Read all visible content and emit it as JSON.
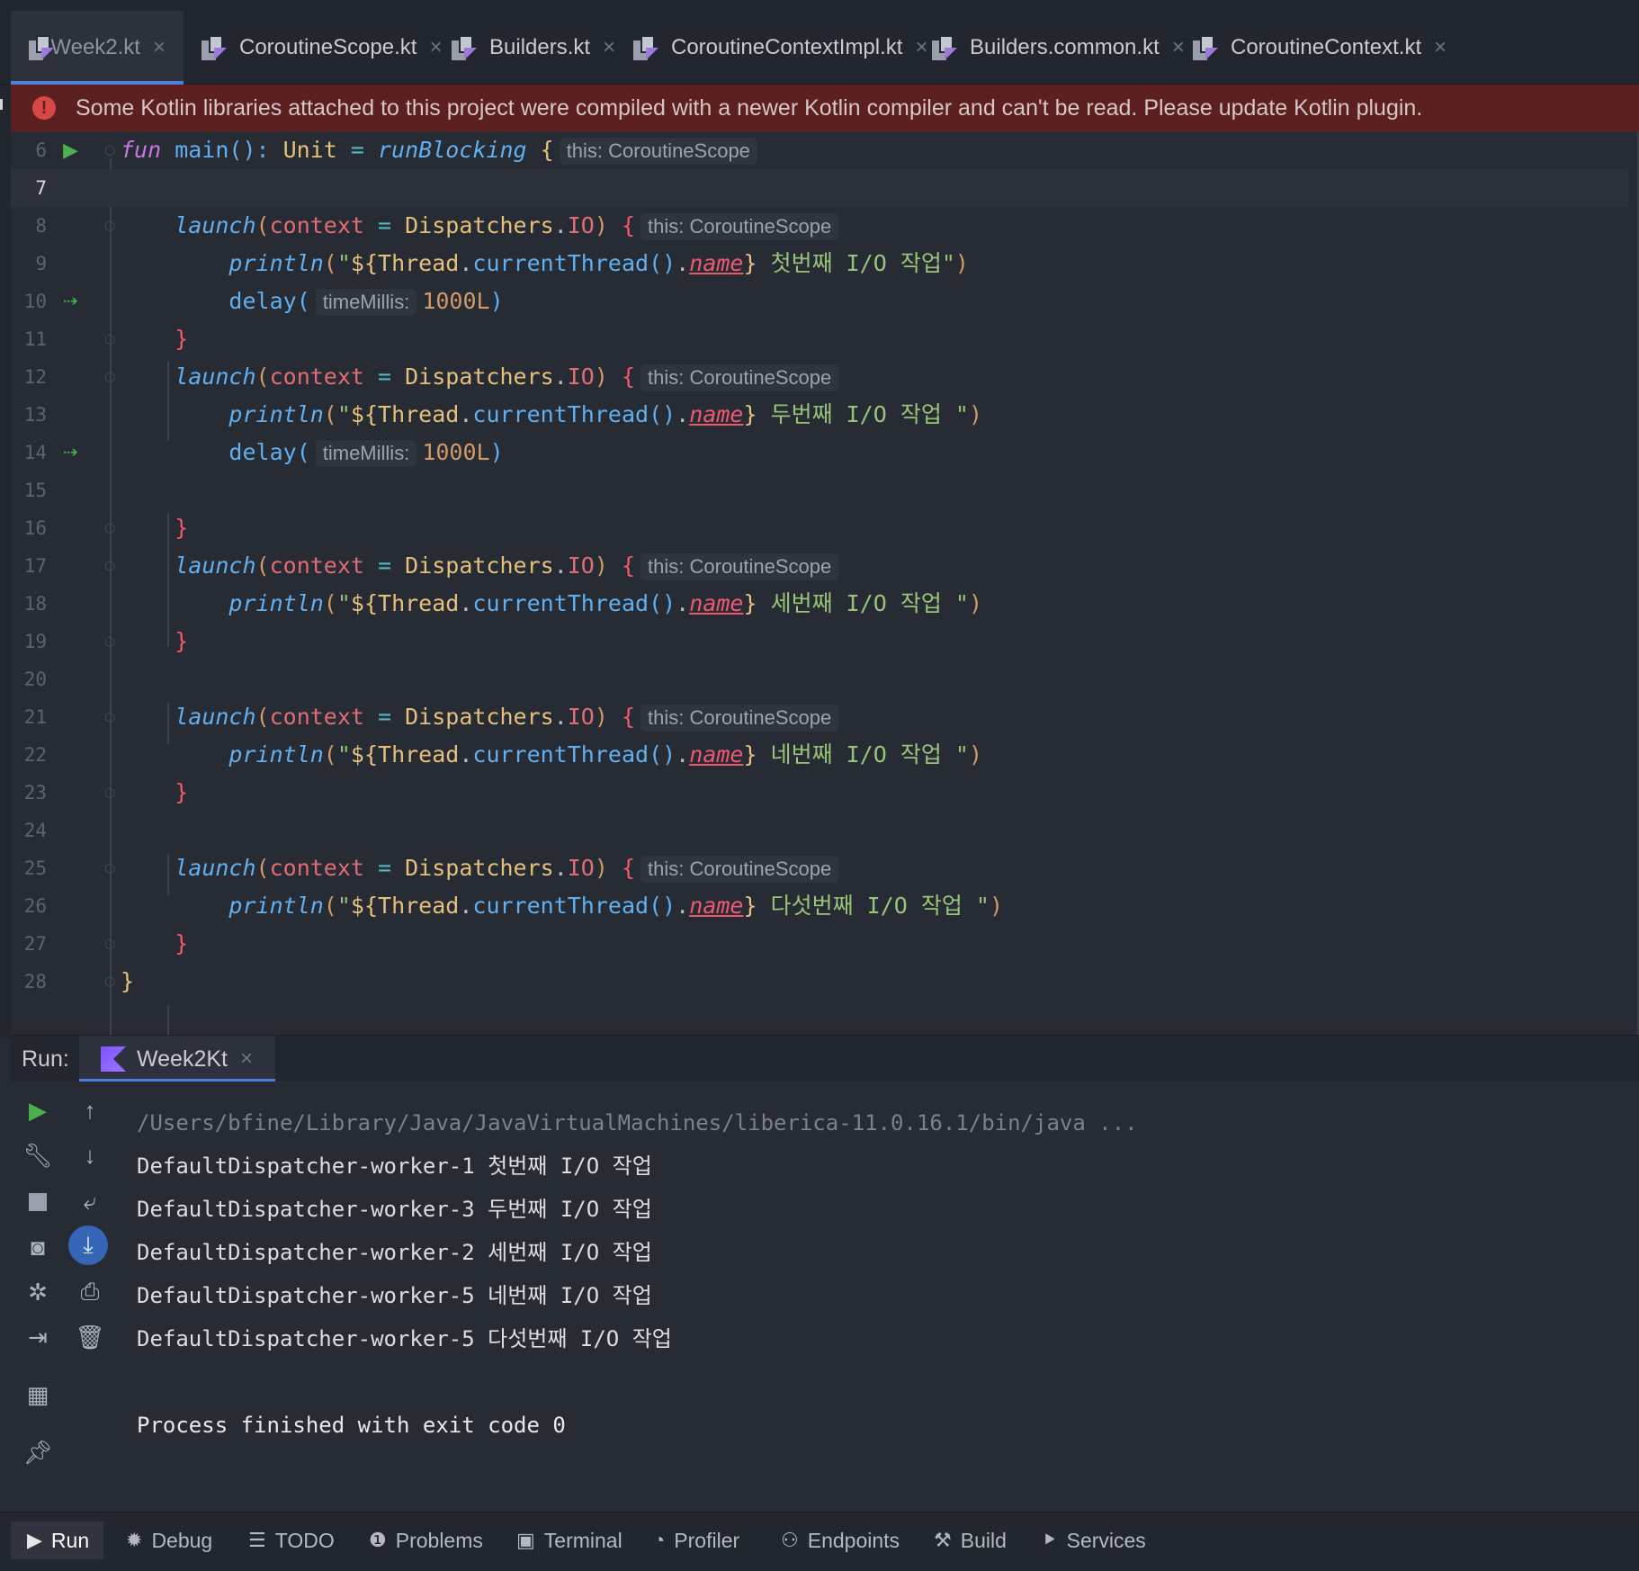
{
  "tabs": [
    {
      "label": "Week2.kt",
      "active": true
    },
    {
      "label": "CoroutineScope.kt",
      "active": false
    },
    {
      "label": "Builders.kt",
      "active": false
    },
    {
      "label": "CoroutineContextImpl.kt",
      "active": false
    },
    {
      "label": "Builders.common.kt",
      "active": false
    },
    {
      "label": "CoroutineContext.kt",
      "active": false
    }
  ],
  "banner": {
    "message": "Some Kotlin libraries attached to this project were compiled with a newer Kotlin compiler and can't be read. Please update Kotlin plugin."
  },
  "editor": {
    "current_line": 7,
    "line_numbers": [
      "6",
      "7",
      "8",
      "9",
      "10",
      "11",
      "12",
      "13",
      "14",
      "15",
      "16",
      "17",
      "18",
      "19",
      "20",
      "21",
      "22",
      "23",
      "24",
      "25",
      "26",
      "27",
      "28"
    ],
    "hints": {
      "this_scope": "this: CoroutineScope",
      "time_millis": "timeMillis:"
    },
    "code": {
      "fun_kw": "fun",
      "main_sig": " main(): ",
      "unit": "Unit",
      "eq": " = ",
      "run_blocking": "runBlocking",
      "open_brace": " {",
      "close_brace": "}",
      "launch": "launch",
      "context_param": "context",
      "dispatchers": "Dispatchers",
      "io": "IO",
      "println": "println",
      "thread": "Thread",
      "current_thread": "currentThread",
      "name": "name",
      "delay": "delay",
      "delay_value": "1000L",
      "msg1": " 첫번째 I/O 작업\"",
      "msg2": " 두번째 I/O 작업 \"",
      "msg3": " 세번째 I/O 작업 \"",
      "msg4": " 네번째 I/O 작업 \"",
      "msg5": " 다섯번째 I/O 작업 \""
    }
  },
  "run_panel": {
    "label": "Run:",
    "tab_label": "Week2Kt",
    "command": "/Users/bfine/Library/Java/JavaVirtualMachines/liberica-11.0.16.1/bin/java ...",
    "output": [
      "DefaultDispatcher-worker-1 첫번째 I/O 작업",
      "DefaultDispatcher-worker-3 두번째 I/O 작업",
      "DefaultDispatcher-worker-2 세번째 I/O 작업",
      "DefaultDispatcher-worker-5 네번째 I/O 작업",
      "DefaultDispatcher-worker-5 다섯번째 I/O 작업"
    ],
    "exit_message": "Process finished with exit code 0"
  },
  "bottom_bar": [
    {
      "label": "Run",
      "icon": "play-icon",
      "active": true
    },
    {
      "label": "Debug",
      "icon": "bug-icon"
    },
    {
      "label": "TODO",
      "icon": "list-icon"
    },
    {
      "label": "Problems",
      "icon": "warning-circle-icon"
    },
    {
      "label": "Terminal",
      "icon": "terminal-icon"
    },
    {
      "label": "Profiler",
      "icon": "profiler-icon"
    },
    {
      "label": "Endpoints",
      "icon": "endpoints-icon"
    },
    {
      "label": "Build",
      "icon": "hammer-icon"
    },
    {
      "label": "Services",
      "icon": "services-icon"
    }
  ],
  "colors": {
    "accent": "#4b80e0",
    "banner_bg": "#5c2020",
    "editor_bg": "#272b34",
    "run_green": "#4caf50"
  }
}
